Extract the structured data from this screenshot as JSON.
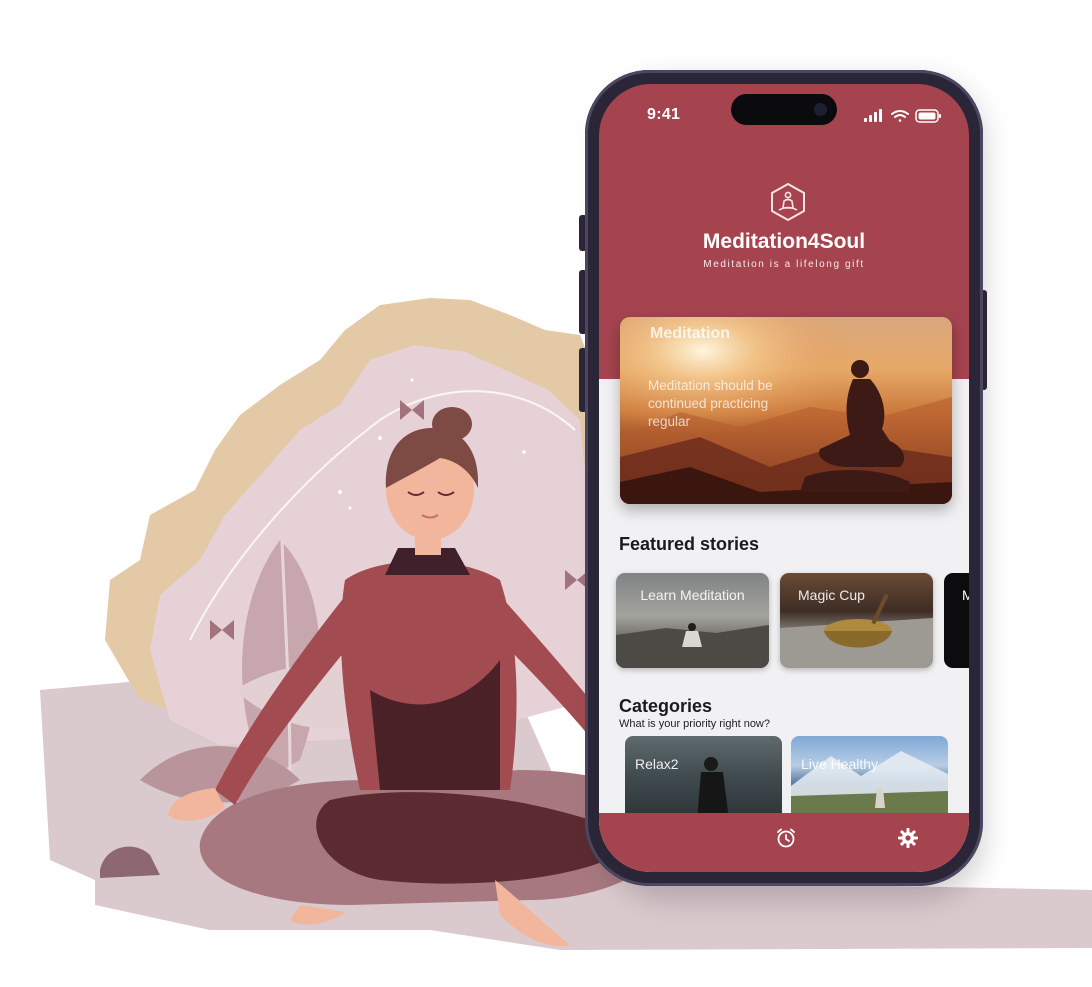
{
  "status_bar": {
    "time": "9:41"
  },
  "app": {
    "title": "Meditation4Soul",
    "tagline": "Meditation is a lifelong gift",
    "logo_icon": "meditation-lotus-hexagon-icon",
    "brand_color": "#a5444e"
  },
  "hero": {
    "title": "Meditation",
    "description": "Meditation should be continued practicing regular"
  },
  "featured": {
    "heading": "Featured stories",
    "stories": [
      {
        "label": "Learn Meditation"
      },
      {
        "label": "Magic Cup"
      },
      {
        "label": "M"
      }
    ]
  },
  "categories": {
    "heading": "Categories",
    "subheading": "What is your priority right now?",
    "items": [
      {
        "label": "Relax2"
      },
      {
        "label": "Live Healthy"
      }
    ]
  },
  "tabbar": {
    "items": [
      {
        "icon": "home-icon"
      },
      {
        "icon": "alarm-clock-icon"
      },
      {
        "icon": "gear-icon"
      }
    ]
  }
}
